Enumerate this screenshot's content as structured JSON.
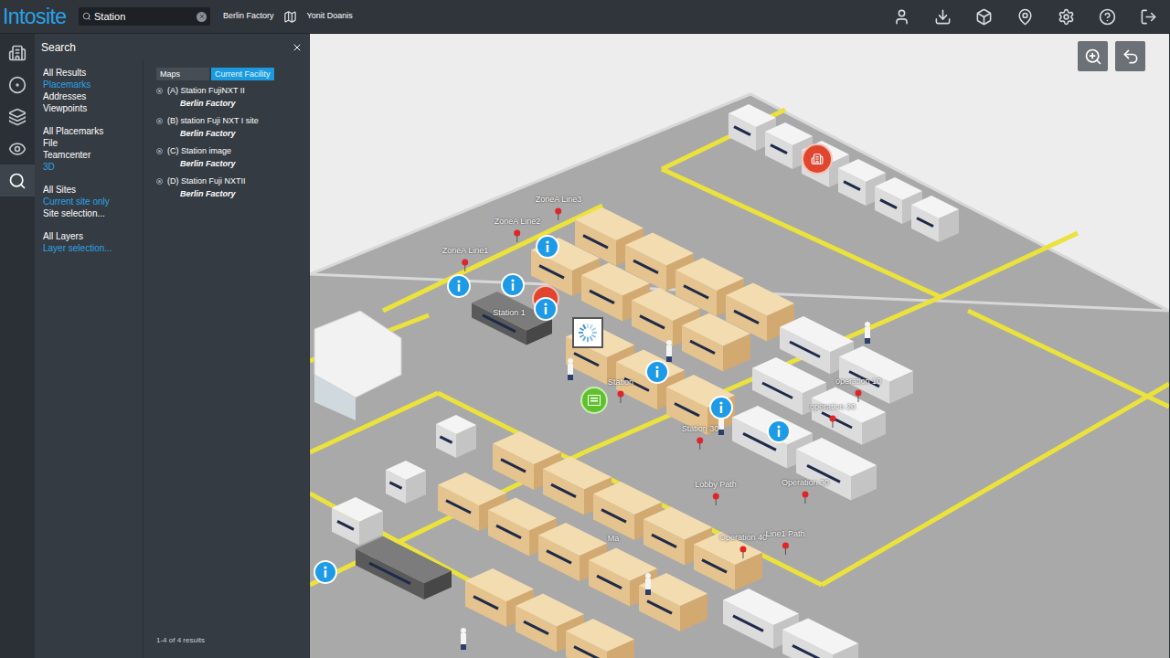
{
  "app": {
    "logo": "Intosite"
  },
  "top_bar": {
    "search": {
      "value": "Station"
    },
    "site": "Berlin Factory",
    "user": "Yonit Doanis"
  },
  "rail": [
    {
      "selected": false
    },
    {
      "selected": false
    },
    {
      "selected": false
    },
    {
      "selected": false
    },
    {
      "selected": true
    }
  ],
  "search_panel": {
    "title": "Search",
    "filter_groups": [
      [
        {
          "label": "All Results",
          "selected": false
        },
        {
          "label": "Placemarks",
          "selected": true
        },
        {
          "label": "Addresses",
          "selected": false
        },
        {
          "label": "Viewpoints",
          "selected": false
        }
      ],
      [
        {
          "label": "All Placemarks",
          "selected": false
        },
        {
          "label": "File",
          "selected": false
        },
        {
          "label": "Teamcenter",
          "selected": false
        },
        {
          "label": "3D",
          "selected": true
        }
      ],
      [
        {
          "label": "All Sites",
          "selected": false
        },
        {
          "label": "Current site only",
          "selected": true
        },
        {
          "label": "Site selection...",
          "selected": false
        }
      ],
      [
        {
          "label": "All Layers",
          "selected": false
        },
        {
          "label": "Layer selection...",
          "selected": true
        }
      ]
    ],
    "tabs": [
      {
        "label": "Maps",
        "selected": false
      },
      {
        "label": "Current Facility",
        "selected": true
      }
    ],
    "results": [
      {
        "label": "(A) Station FujiNXT II",
        "site": "Berlin Factory"
      },
      {
        "label": "(B) station Fuji NXT I site",
        "site": "Berlin Factory"
      },
      {
        "label": "(C) Station image",
        "site": "Berlin Factory"
      },
      {
        "label": "(D) Station Fuji NXTII",
        "site": "Berlin Factory"
      }
    ],
    "footer": "1-4 of 4 results"
  },
  "map": {
    "labels": [
      {
        "text": "ZoneA Line3",
        "pin": true
      },
      {
        "text": "ZoneA Line2",
        "pin": true
      },
      {
        "text": "ZoneA Line1",
        "pin": true
      },
      {
        "text": "Station 1",
        "pin": false
      },
      {
        "text": "Station",
        "pin": true
      },
      {
        "text": "Station 30",
        "pin": true
      },
      {
        "text": "operation 10",
        "pin": true
      },
      {
        "text": "operation 20",
        "pin": true
      },
      {
        "text": "Lobby Path",
        "pin": true
      },
      {
        "text": "Operation 30",
        "pin": true
      },
      {
        "text": "Operation 40",
        "pin": true
      },
      {
        "text": "Line1 Path",
        "pin": true
      },
      {
        "text": "Ma",
        "pin": false
      }
    ]
  }
}
